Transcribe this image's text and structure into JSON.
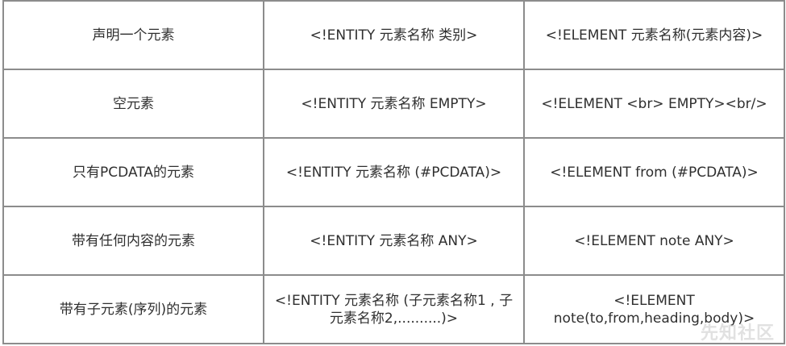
{
  "table": {
    "rows": [
      {
        "label": "声明一个元素",
        "entity": "<!ENTITY 元素名称 类别>",
        "example": "<!ELEMENT 元素名称(元素内容)>"
      },
      {
        "label": "空元素",
        "entity": "<!ENTITY 元素名称 EMPTY>",
        "example": "<!ELEMENT <br> EMPTY><br/>"
      },
      {
        "label": "只有PCDATA的元素",
        "entity": "<!ENTITY 元素名称 (#PCDATA)>",
        "example": "<!ELEMENT from (#PCDATA)>"
      },
      {
        "label": "带有任何内容的元素",
        "entity": "<!ENTITY 元素名称 ANY>",
        "example": "<!ELEMENT note ANY>"
      },
      {
        "label": "带有子元素(序列)的元素",
        "entity": "<!ENTITY 元素名称 (子元素名称1 , 子元素名称2,..........)>",
        "example": "<!ELEMENT note(to,from,heading,body)>"
      }
    ]
  },
  "watermark": "先知社区"
}
